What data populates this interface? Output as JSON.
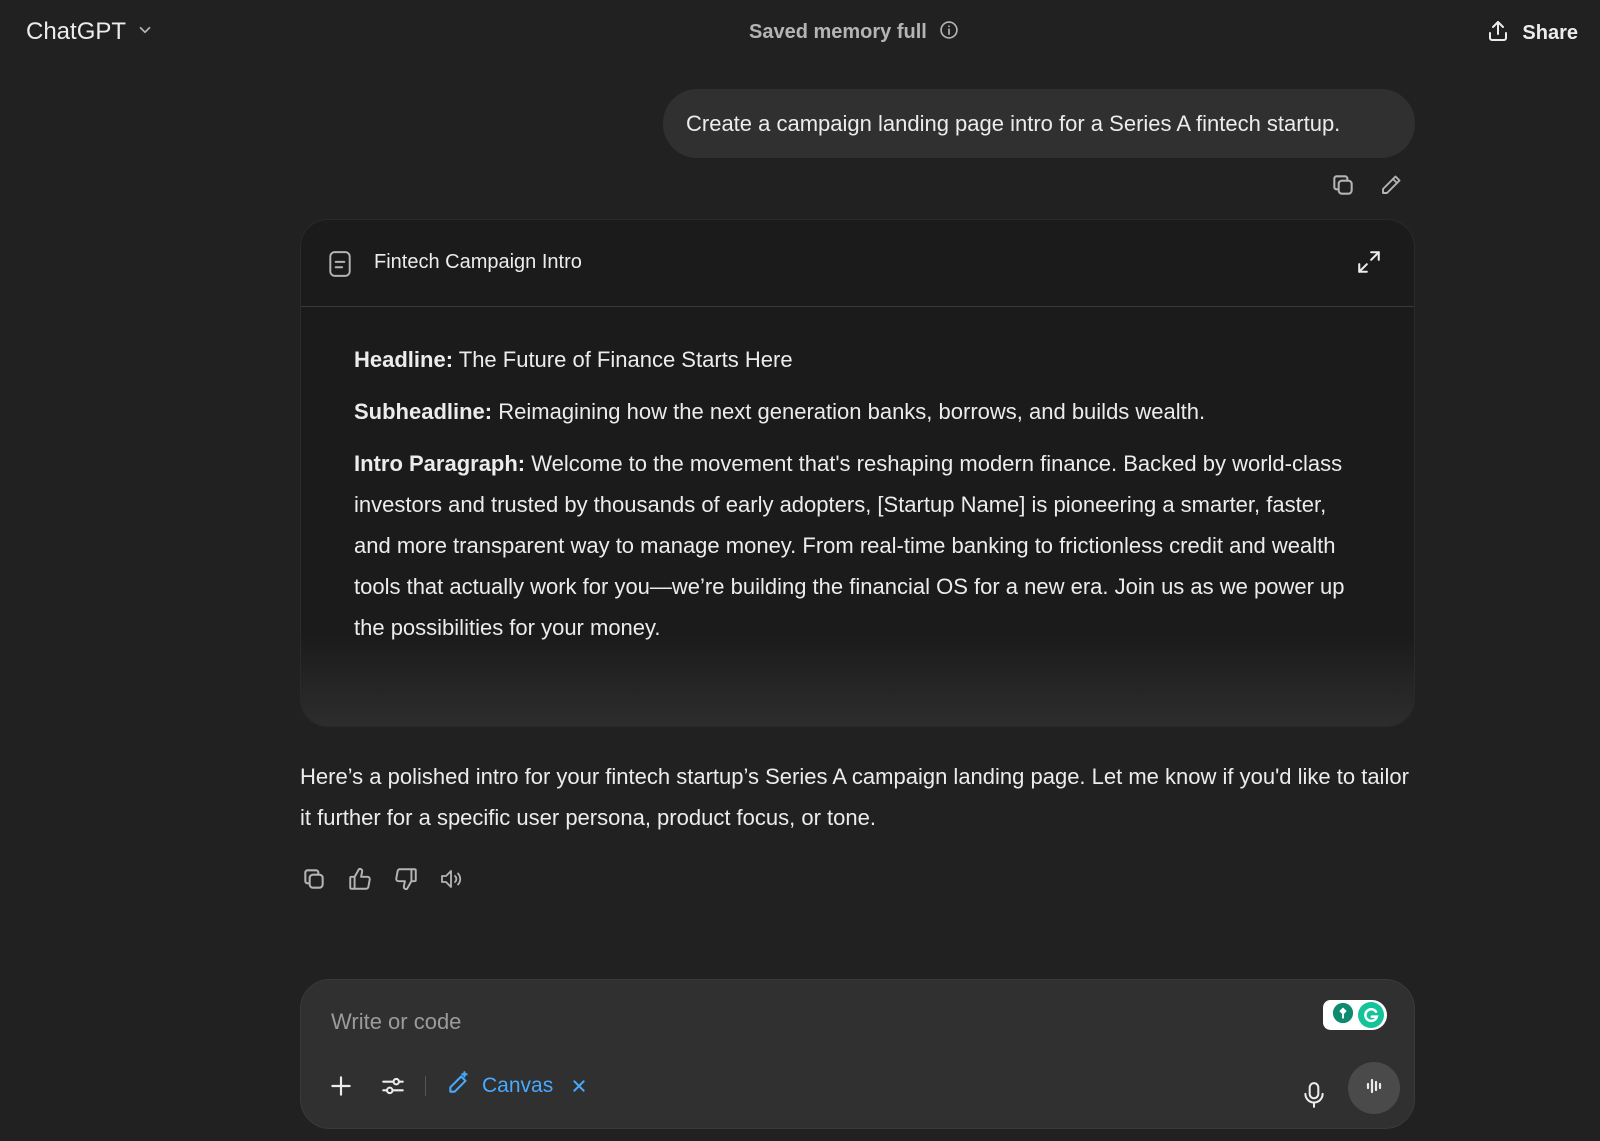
{
  "header": {
    "model_name": "ChatGPT",
    "memory_status": "Saved memory full",
    "share_label": "Share"
  },
  "conversation": {
    "user_message": "Create a campaign landing page intro for a Series A fintech startup.",
    "canvas": {
      "title": "Fintech Campaign Intro",
      "headline_label": "Headline:",
      "headline_value": "The Future of Finance Starts Here",
      "subheadline_label": "Subheadline:",
      "subheadline_value": "Reimagining how the next generation banks, borrows, and builds wealth.",
      "intro_label": "Intro Paragraph:",
      "intro_value": "Welcome to the movement that's reshaping modern finance. Backed by world-class investors and trusted by thousands of early adopters, [Startup Name] is pioneering a smarter, faster, and more transparent way to manage money. From real-time banking to frictionless credit and wealth tools that actually work for you—we’re building the financial OS for a new era. Join us as we power up the possibilities for your money."
    },
    "assistant_message": "Here’s a polished intro for your fintech startup’s Series A campaign landing page. Let me know if you'd like to tailor it further for a specific user persona, product focus, or tone."
  },
  "composer": {
    "placeholder": "Write or code",
    "tool_chip_label": "Canvas",
    "accent_color": "#48aaff"
  },
  "icons": [
    "chevron-down-icon",
    "info-icon",
    "share-upload-icon",
    "copy-icon",
    "edit-pencil-icon",
    "document-icon",
    "expand-icon",
    "thumbs-up-icon",
    "thumbs-down-icon",
    "read-aloud-icon",
    "grammarly-icon",
    "plus-icon",
    "tools-sliders-icon",
    "canvas-pen-icon",
    "close-icon",
    "microphone-icon",
    "voice-mode-icon"
  ]
}
